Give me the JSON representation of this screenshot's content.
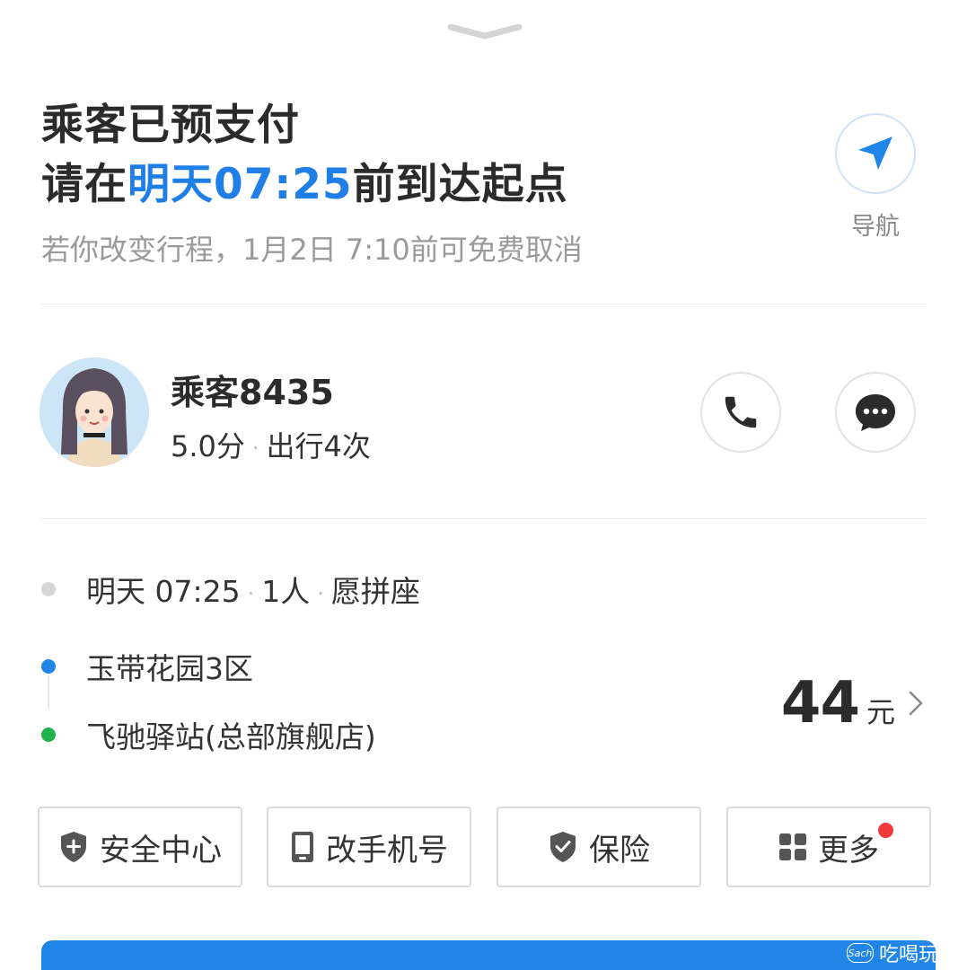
{
  "header": {
    "title_line1": "乘客已预支付",
    "title_line2_prefix": "请在",
    "title_line2_highlight": "明天07:25",
    "title_line2_suffix": "前到达起点",
    "subtitle": "若你改变行程，1月2日 7:10前可免费取消"
  },
  "navigation": {
    "label": "导航",
    "icon": "navigation-arrow-icon"
  },
  "passenger": {
    "name": "乘客8435",
    "rating": "5.0分",
    "trips": "出行4次",
    "separator": "·"
  },
  "trip": {
    "time": "明天 07:25",
    "seats": "1人",
    "carpool": "愿拼座",
    "separator": "·",
    "start": "玉带花园3区",
    "end": "飞驰驿站(总部旗舰店)"
  },
  "price": {
    "amount": "44",
    "unit": "元"
  },
  "actions": [
    {
      "label": "安全中心",
      "icon": "shield-plus-icon"
    },
    {
      "label": "改手机号",
      "icon": "phone-icon"
    },
    {
      "label": "保险",
      "icon": "shield-check-icon"
    },
    {
      "label": "更多",
      "icon": "grid-icon"
    }
  ],
  "watermark": {
    "badge": "Sach",
    "text": "吃喝玩乐"
  },
  "colors": {
    "accent": "#1f7fe6",
    "start_dot": "#1f86e8",
    "end_dot": "#22b24c",
    "notification_dot": "#f23a3a"
  }
}
